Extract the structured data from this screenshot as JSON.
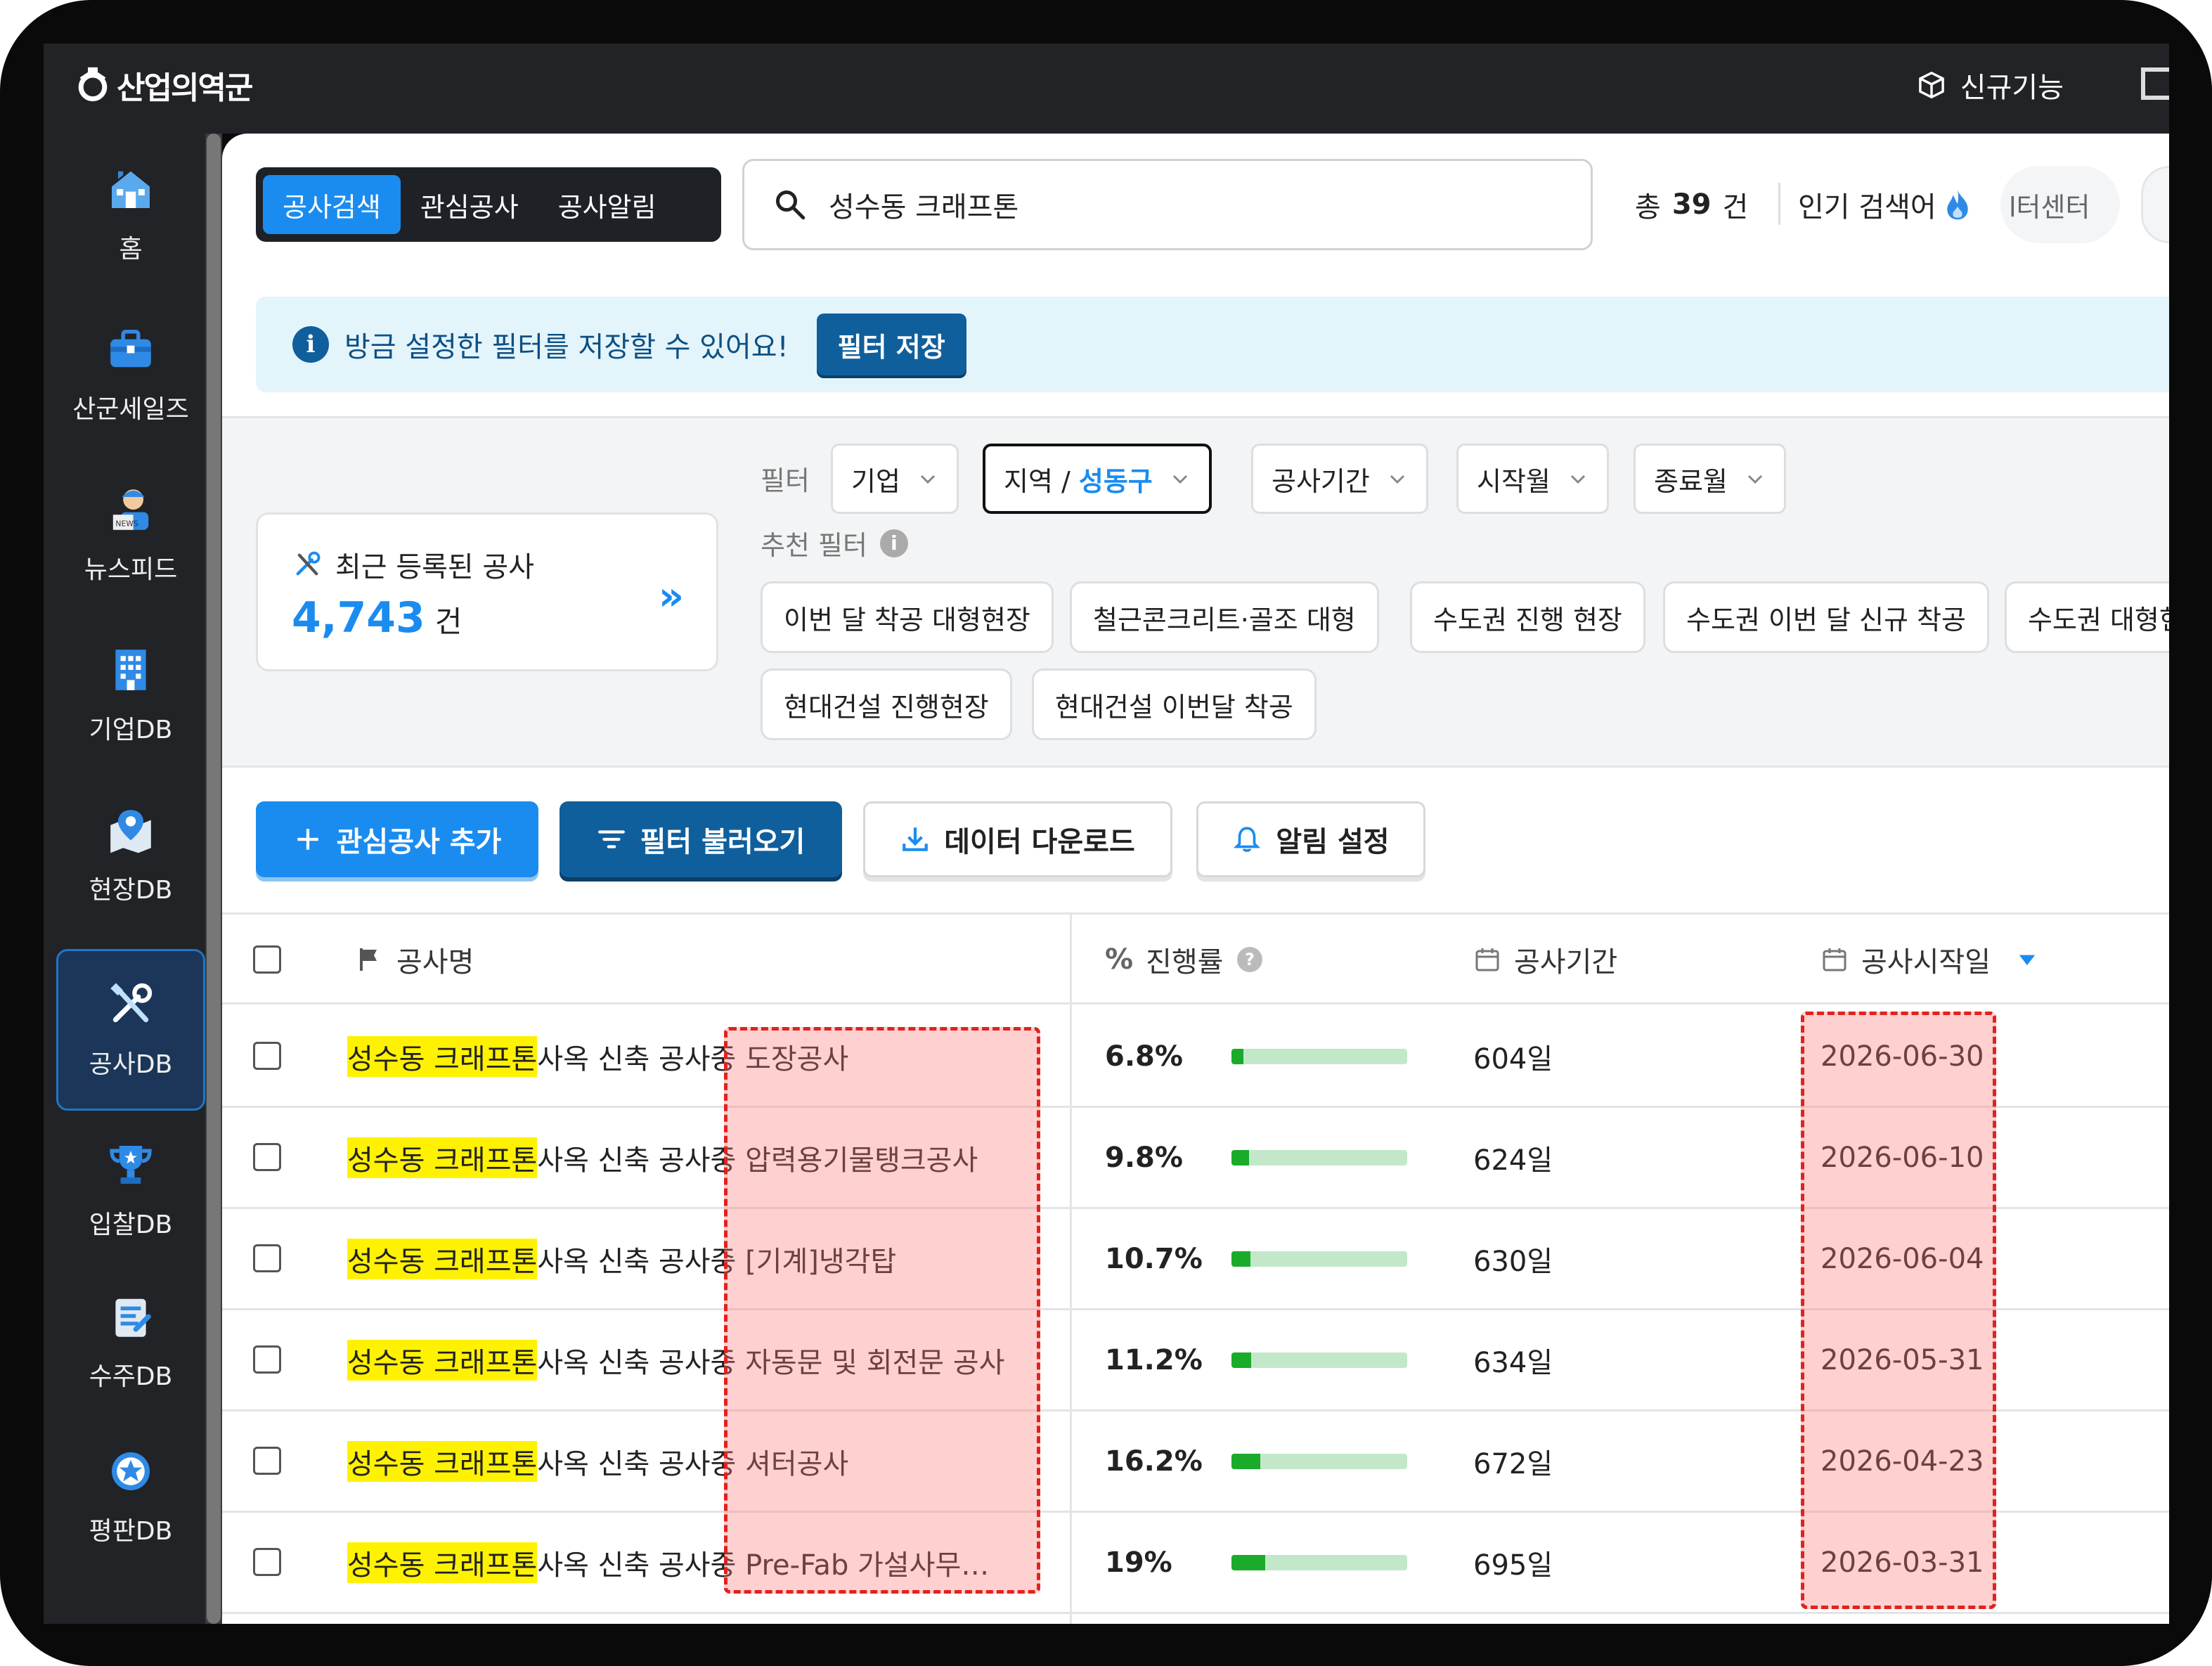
{
  "app": {
    "logo": "산업의역군",
    "new_features": "신규기능"
  },
  "sidebar": {
    "items": [
      {
        "label": "홈",
        "icon": "home-icon"
      },
      {
        "label": "산군세일즈",
        "icon": "briefcase-icon"
      },
      {
        "label": "뉴스피드",
        "icon": "news-reader-icon"
      },
      {
        "label": "기업DB",
        "icon": "building-icon"
      },
      {
        "label": "현장DB",
        "icon": "map-pin-icon"
      },
      {
        "label": "공사DB",
        "icon": "tools-icon",
        "active": true
      },
      {
        "label": "입찰DB",
        "icon": "trophy-icon"
      },
      {
        "label": "수주DB",
        "icon": "clipboard-icon"
      },
      {
        "label": "평판DB",
        "icon": "star-badge-icon"
      }
    ]
  },
  "tabs": [
    {
      "label": "공사검색",
      "active": true
    },
    {
      "label": "관심공사"
    },
    {
      "label": "공사알림"
    }
  ],
  "search": {
    "value": "성수동 크래프톤"
  },
  "summary": {
    "total_prefix": "총",
    "total_count": "39",
    "total_suffix": "건",
    "popular_label": "인기 검색어",
    "center_chip": "l터센터"
  },
  "banner": {
    "message": "방금 설정한 필터를 저장할 수 있어요!",
    "save_button": "필터 저장"
  },
  "recent": {
    "title": "최근 등록된 공사",
    "count": "4,743",
    "unit": "건"
  },
  "filters": {
    "label": "필터",
    "chips": [
      {
        "label": "기업"
      },
      {
        "label": "지역 / ",
        "value": "성동구",
        "selected": true
      },
      {
        "label": "공사기간"
      },
      {
        "label": "시작월"
      },
      {
        "label": "종료월"
      }
    ],
    "recommended_label": "추천 필터",
    "recommended": [
      "이번 달 착공 대형현장",
      "철근콘크리트·골조 대형",
      "수도권 진행 현장",
      "수도권 이번 달 신규 착공",
      "수도권 대형현",
      "현대건설 진행현장",
      "현대건설 이번달 착공"
    ]
  },
  "actions": {
    "add": "관심공사 추가",
    "load_filter": "필터 불러오기",
    "download": "데이터 다운로드",
    "alarm": "알림 설정"
  },
  "table": {
    "headers": {
      "name": "공사명",
      "progress": "진행률",
      "period": "공사기간",
      "start": "공사시작일"
    },
    "rows": [
      {
        "highlight": "성수동 크래프톤",
        "rest": "사옥 신축 공사중 도장공사",
        "progress_label": "6.8%",
        "progress": 0.068,
        "period": "604일",
        "start": "2026-06-30"
      },
      {
        "highlight": "성수동 크래프톤",
        "rest": "사옥 신축 공사중 압력용기물탱크공사",
        "progress_label": "9.8%",
        "progress": 0.098,
        "period": "624일",
        "start": "2026-06-10"
      },
      {
        "highlight": "성수동 크래프톤",
        "rest": "사옥 신축 공사중 [기계]냉각탑",
        "progress_label": "10.7%",
        "progress": 0.107,
        "period": "630일",
        "start": "2026-06-04"
      },
      {
        "highlight": "성수동 크래프톤",
        "rest": "사옥 신축 공사중 자동문 및 회전문 공사",
        "progress_label": "11.2%",
        "progress": 0.112,
        "period": "634일",
        "start": "2026-05-31"
      },
      {
        "highlight": "성수동 크래프톤",
        "rest": "사옥 신축 공사중 셔터공사",
        "progress_label": "16.2%",
        "progress": 0.162,
        "period": "672일",
        "start": "2026-04-23"
      },
      {
        "highlight": "성수동 크래프톤",
        "rest": "사옥 신축 공사중 Pre-Fab 가설사무…",
        "progress_label": "19%",
        "progress": 0.19,
        "period": "695일",
        "start": "2026-03-31"
      }
    ]
  },
  "colors": {
    "accent": "#1a8cf0",
    "dark_blue": "#0f5f9c",
    "highlight": "#fff200",
    "progress_fill": "#1aab2b",
    "progress_track": "#c3e8c9",
    "annotation": "#e0231d"
  }
}
